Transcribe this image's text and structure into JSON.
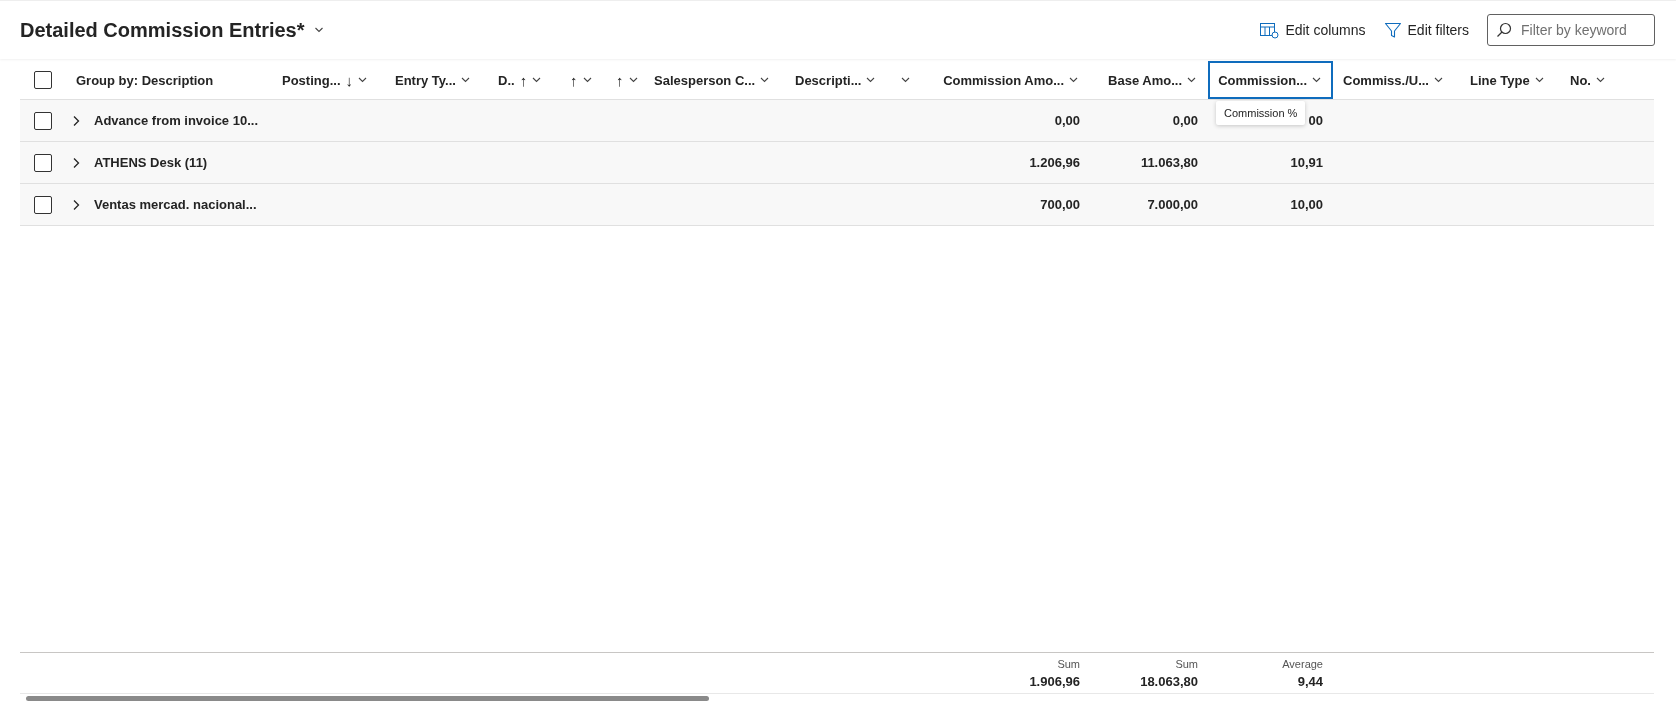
{
  "title": "Detailed Commission Entries*",
  "toolbar": [
    {
      "kind": "columns",
      "label": "Edit columns"
    },
    {
      "kind": "filter",
      "label": "Edit filters"
    }
  ],
  "search": {
    "placeholder": "Filter by keyword"
  },
  "select_all": {
    "selected": false
  },
  "columns": [
    {
      "label": "Group by: Description",
      "focused": false
    },
    {
      "label": "Posting...",
      "sort": "↓",
      "menu": true,
      "focused": false
    },
    {
      "label": "Entry Ty...",
      "menu": true,
      "focused": false
    },
    {
      "label": "D..",
      "sort": "↑",
      "menu": true,
      "focused": false
    },
    {
      "sort": "↑",
      "menu": true,
      "focused": false
    },
    {
      "sort": "↑",
      "menu": true,
      "focused": false
    },
    {
      "label": "Salesperson C...",
      "menu": true,
      "focused": false
    },
    {
      "label": "Descripti...",
      "menu": true,
      "focused": false
    },
    {
      "menu": true,
      "focused": false
    },
    {
      "label": "Commission Amo...",
      "menu": true,
      "focused": false,
      "total": {
        "label": "Sum",
        "value": "1.906,96"
      }
    },
    {
      "label": "Base Amo...",
      "menu": true,
      "focused": false,
      "total": {
        "label": "Sum",
        "value": "18.063,80"
      }
    },
    {
      "label": "Commission...",
      "menu": true,
      "focused": true,
      "tooltip": "Commission %",
      "total": {
        "label": "Average",
        "value": "9,44"
      }
    },
    {
      "label": "Commiss./U...",
      "menu": true,
      "focused": false
    },
    {
      "label": "Line Type",
      "menu": true,
      "focused": false
    },
    {
      "label": "No.",
      "menu": true,
      "focused": false
    }
  ],
  "rows": [
    {
      "group": "Advance from invoice 10...",
      "selected": false,
      "expanded": false,
      "commission_amount": "0,00",
      "base_amount": "0,00",
      "commission_pct": "00"
    },
    {
      "group": "ATHENS Desk (11)",
      "selected": false,
      "expanded": false,
      "commission_amount": "1.206,96",
      "base_amount": "11.063,80",
      "commission_pct": "10,91"
    },
    {
      "group": "Ventas mercad. nacional...",
      "selected": false,
      "expanded": false,
      "commission_amount": "700,00",
      "base_amount": "7.000,00",
      "commission_pct": "10,00"
    }
  ]
}
